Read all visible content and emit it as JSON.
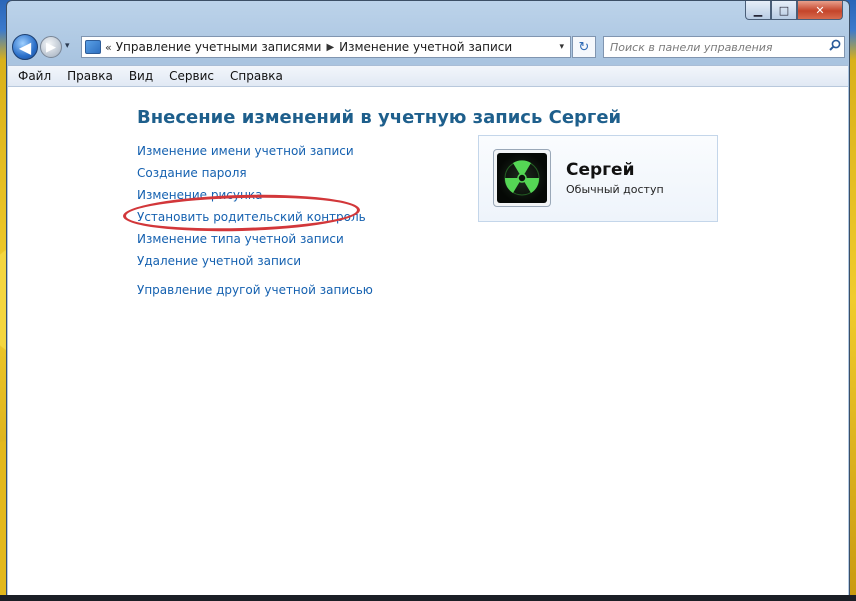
{
  "window": {
    "caption": {
      "minimize_symbol": "▁",
      "maximize_symbol": "□",
      "close_symbol": "✕"
    }
  },
  "navigation": {
    "back_symbol": "◀",
    "forward_symbol": "▶",
    "dropdown_symbol": "▾",
    "address": {
      "chevron": "«",
      "crumbs": [
        "Управление учетными записями",
        "Изменение учетной записи"
      ],
      "separator": "▶"
    },
    "refresh_symbol": "↻",
    "search": {
      "placeholder": "Поиск в панели управления",
      "value": ""
    }
  },
  "menubar": {
    "items": [
      "Файл",
      "Правка",
      "Вид",
      "Сервис",
      "Справка"
    ]
  },
  "main": {
    "heading": "Внесение изменений в учетную запись Сергей",
    "links": [
      "Изменение имени учетной записи",
      "Создание пароля",
      "Изменение рисунка",
      "Установить родительский контроль",
      "Изменение типа учетной записи",
      "Удаление учетной записи",
      "Управление другой учетной записью"
    ],
    "highlighted_link_index": 3
  },
  "account": {
    "name": "Сергей",
    "type": "Обычный доступ",
    "avatar_icon": "radiation-icon"
  },
  "colors": {
    "link": "#1561b0",
    "heading": "#1e5f8c",
    "highlight": "#d2373a"
  }
}
